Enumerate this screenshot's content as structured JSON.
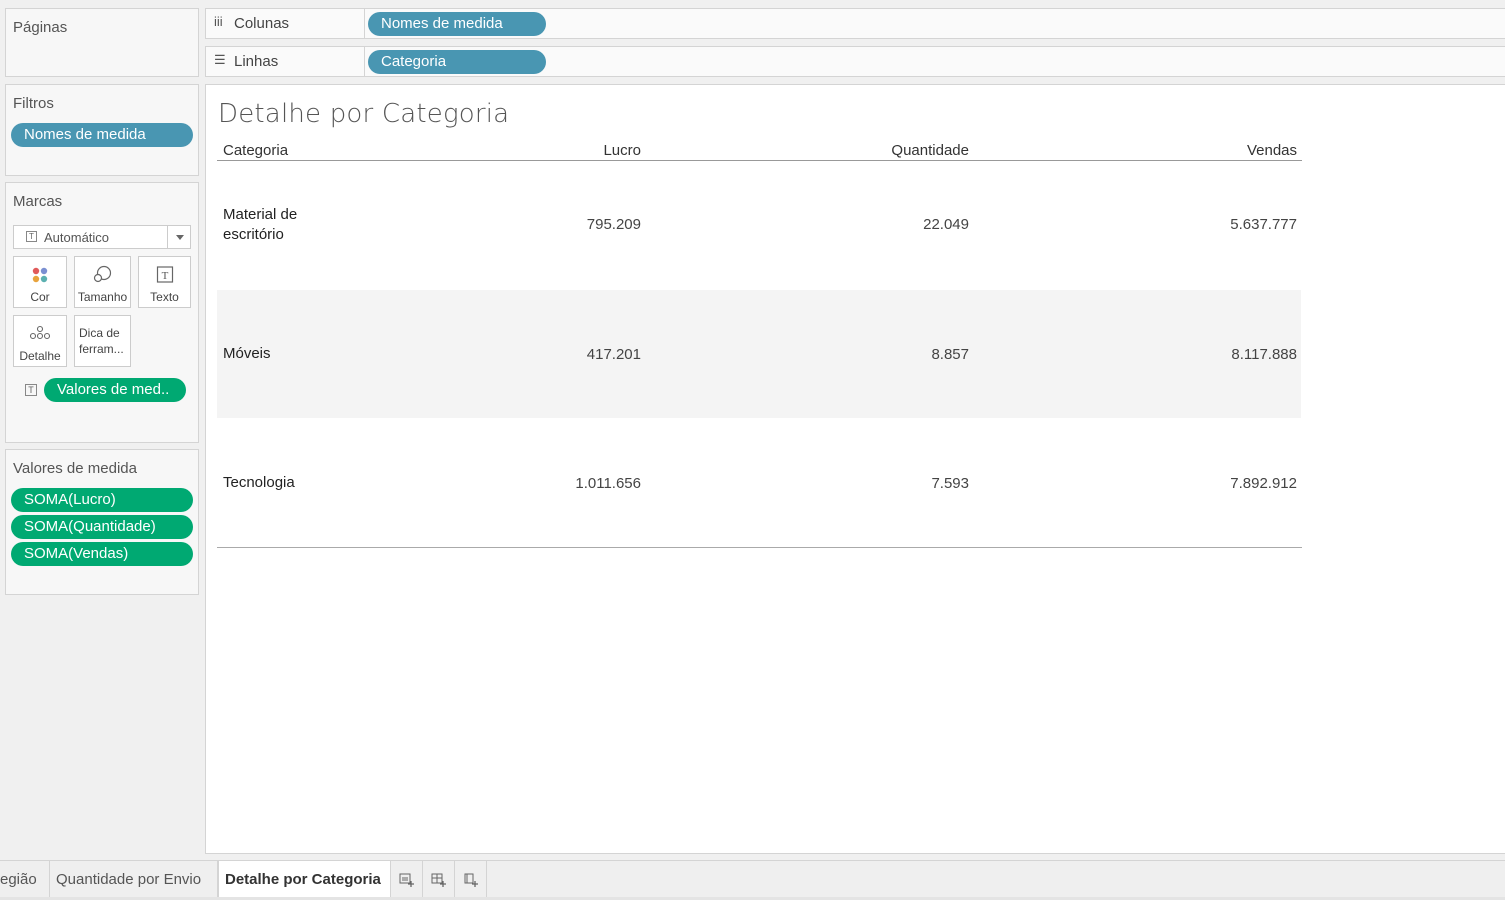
{
  "pages_card": {
    "title": "Páginas"
  },
  "filters_card": {
    "title": "Filtros",
    "pills": [
      "Nomes de medida"
    ]
  },
  "marks_card": {
    "title": "Marcas",
    "mark_type": "Automático",
    "buttons": {
      "color": "Cor",
      "size": "Tamanho",
      "text": "Texto",
      "detail": "Detalhe",
      "tooltip": "Dica de ferram..."
    },
    "text_pill": "Valores de med.."
  },
  "measure_values_card": {
    "title": "Valores de medida",
    "pills": [
      "SOMA(Lucro)",
      "SOMA(Quantidade)",
      "SOMA(Vendas)"
    ]
  },
  "shelves": {
    "columns": {
      "label": "Colunas",
      "pill": "Nomes de medida"
    },
    "rows": {
      "label": "Linhas",
      "pill": "Categoria"
    }
  },
  "view": {
    "title": "Detalhe por Categoria",
    "headers": [
      "Categoria",
      "Lucro",
      "Quantidade",
      "Vendas"
    ],
    "rows": [
      {
        "category": [
          "Material de",
          "escritório"
        ],
        "lucro": "795.209",
        "quantidade": "22.049",
        "vendas": "5.637.777"
      },
      {
        "category": [
          "Móveis"
        ],
        "lucro": "417.201",
        "quantidade": "8.857",
        "vendas": "8.117.888"
      },
      {
        "category": [
          "Tecnologia"
        ],
        "lucro": "1.011.656",
        "quantidade": "7.593",
        "vendas": "7.892.912"
      }
    ]
  },
  "tabs": [
    "egião",
    "Quantidade por Envio",
    "Detalhe por Categoria"
  ],
  "active_tab": "Detalhe por Categoria",
  "colors": {
    "blue_pill": "#4996b2",
    "green_pill": "#00a972"
  }
}
